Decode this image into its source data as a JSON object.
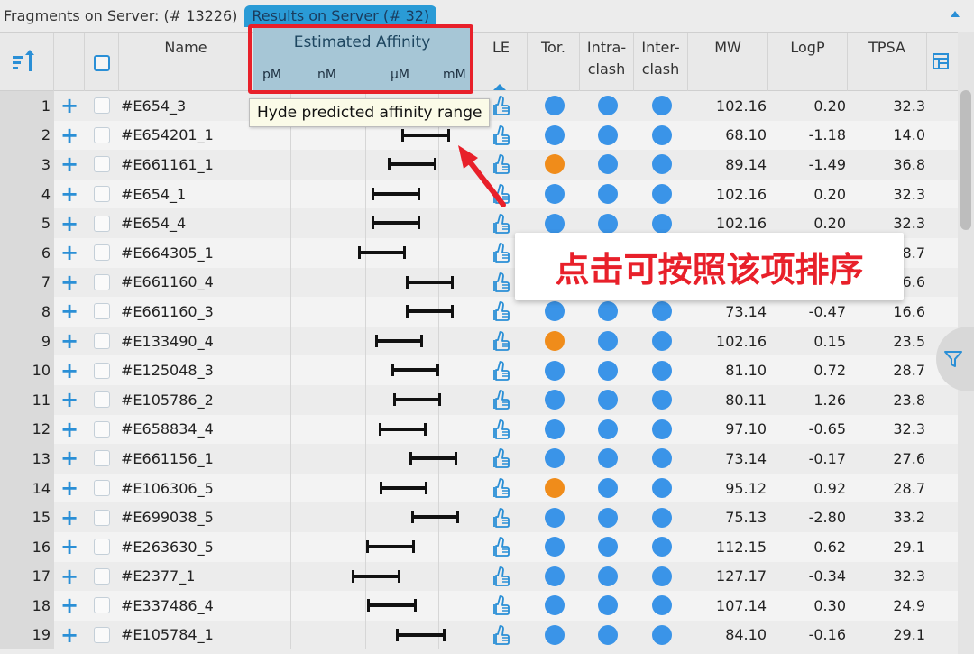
{
  "topbar": {
    "fragments_label": "Fragments on Server: (# 13226)",
    "results_tab": "Results on Server (# 32)"
  },
  "header": {
    "name": "Name",
    "affinity_title": "Estimated Affinity",
    "affinity_scale": [
      "pM",
      "nM",
      "μM",
      "mM"
    ],
    "le": "LE",
    "tor": "Tor.",
    "intra": "Intra-\nclash",
    "inter": "Inter-\nclash",
    "mw": "MW",
    "logp": "LogP",
    "tpsa": "TPSA"
  },
  "tooltip": "Hyde predicted affinity range",
  "callout": "点击可按照该项排序",
  "colors": {
    "accent": "#2a8fd6",
    "dot_blue": "#3a94e8",
    "dot_orange": "#f08c1a",
    "annotation_red": "#e8202a"
  },
  "rows": [
    {
      "idx": "1",
      "name": "#E654_3",
      "tor": "blue",
      "mw": "102.16",
      "logp": "0.20",
      "tpsa": "32.3",
      "range": [
        148,
        200
      ]
    },
    {
      "idx": "2",
      "name": "#E654201_1",
      "tor": "blue",
      "mw": "68.10",
      "logp": "-1.18",
      "tpsa": "14.0",
      "range": [
        165,
        217
      ]
    },
    {
      "idx": "3",
      "name": "#E661161_1",
      "tor": "orange",
      "mw": "89.14",
      "logp": "-1.49",
      "tpsa": "36.8",
      "range": [
        150,
        202
      ]
    },
    {
      "idx": "4",
      "name": "#E654_1",
      "tor": "blue",
      "mw": "102.16",
      "logp": "0.20",
      "tpsa": "32.3",
      "range": [
        132,
        184
      ]
    },
    {
      "idx": "5",
      "name": "#E654_4",
      "tor": "blue",
      "mw": "102.16",
      "logp": "0.20",
      "tpsa": "32.3",
      "range": [
        132,
        184
      ]
    },
    {
      "idx": "6",
      "name": "#E664305_1",
      "tor": "blue",
      "mw": "",
      "logp": "",
      "tpsa": "28.7",
      "range": [
        117,
        168
      ]
    },
    {
      "idx": "7",
      "name": "#E661160_4",
      "tor": "blue",
      "mw": "",
      "logp": "",
      "tpsa": "16.6",
      "range": [
        170,
        221
      ]
    },
    {
      "idx": "8",
      "name": "#E661160_3",
      "tor": "blue",
      "mw": "73.14",
      "logp": "-0.47",
      "tpsa": "16.6",
      "range": [
        170,
        221
      ]
    },
    {
      "idx": "9",
      "name": "#E133490_4",
      "tor": "orange",
      "mw": "102.16",
      "logp": "0.15",
      "tpsa": "23.5",
      "range": [
        136,
        187
      ]
    },
    {
      "idx": "10",
      "name": "#E125048_3",
      "tor": "blue",
      "mw": "81.10",
      "logp": "0.72",
      "tpsa": "28.7",
      "range": [
        154,
        205
      ]
    },
    {
      "idx": "11",
      "name": "#E105786_2",
      "tor": "blue",
      "mw": "80.11",
      "logp": "1.26",
      "tpsa": "23.8",
      "range": [
        156,
        207
      ]
    },
    {
      "idx": "12",
      "name": "#E658834_4",
      "tor": "blue",
      "mw": "97.10",
      "logp": "-0.65",
      "tpsa": "32.3",
      "range": [
        140,
        191
      ]
    },
    {
      "idx": "13",
      "name": "#E661156_1",
      "tor": "blue",
      "mw": "73.14",
      "logp": "-0.17",
      "tpsa": "27.6",
      "range": [
        174,
        225
      ]
    },
    {
      "idx": "14",
      "name": "#E106306_5",
      "tor": "orange",
      "mw": "95.12",
      "logp": "0.92",
      "tpsa": "28.7",
      "range": [
        141,
        192
      ]
    },
    {
      "idx": "15",
      "name": "#E699038_5",
      "tor": "blue",
      "mw": "75.13",
      "logp": "-2.80",
      "tpsa": "33.2",
      "range": [
        176,
        227
      ]
    },
    {
      "idx": "16",
      "name": "#E263630_5",
      "tor": "blue",
      "mw": "112.15",
      "logp": "0.62",
      "tpsa": "29.1",
      "range": [
        126,
        178
      ]
    },
    {
      "idx": "17",
      "name": "#E2377_1",
      "tor": "blue",
      "mw": "127.17",
      "logp": "-0.34",
      "tpsa": "32.3",
      "range": [
        110,
        162
      ]
    },
    {
      "idx": "18",
      "name": "#E337486_4",
      "tor": "blue",
      "mw": "107.14",
      "logp": "0.30",
      "tpsa": "24.9",
      "range": [
        127,
        180
      ]
    },
    {
      "idx": "19",
      "name": "#E105784_1",
      "tor": "blue",
      "mw": "84.10",
      "logp": "-0.16",
      "tpsa": "29.1",
      "range": [
        159,
        212
      ]
    }
  ]
}
